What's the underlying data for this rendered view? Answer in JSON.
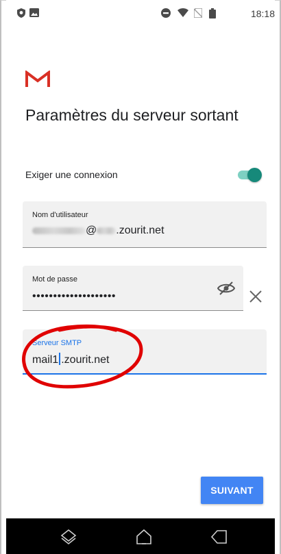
{
  "status_bar": {
    "time": "18:18",
    "left_icons": [
      "shield-icon",
      "image-icon"
    ],
    "right_icons": [
      "do-not-disturb-icon",
      "wifi-icon",
      "no-sim-icon",
      "battery-icon"
    ]
  },
  "app": {
    "logo": "gmail-logo"
  },
  "page": {
    "title": "Paramètres du serveur sortant"
  },
  "require_connection": {
    "label": "Exiger une connexion",
    "enabled": true
  },
  "username_field": {
    "label": "Nom d'utilisateur",
    "value_visible": "@",
    "value_suffix": ".zourit.net"
  },
  "password_field": {
    "label": "Mot de passe",
    "masked_value": "••••••••••••••••••••"
  },
  "smtp_field": {
    "label": "Serveur SMTP",
    "value_before_cursor": "mail1",
    "value_after_cursor": ".zourit.net"
  },
  "next_button": {
    "label": "SUIVANT"
  },
  "colors": {
    "accent": "#1a73e8",
    "button": "#4285f4",
    "toggle": "#16897a",
    "annotation": "#e00000"
  },
  "nav_bar": {
    "icons": [
      "recent-apps-icon",
      "home-icon",
      "back-icon"
    ]
  }
}
